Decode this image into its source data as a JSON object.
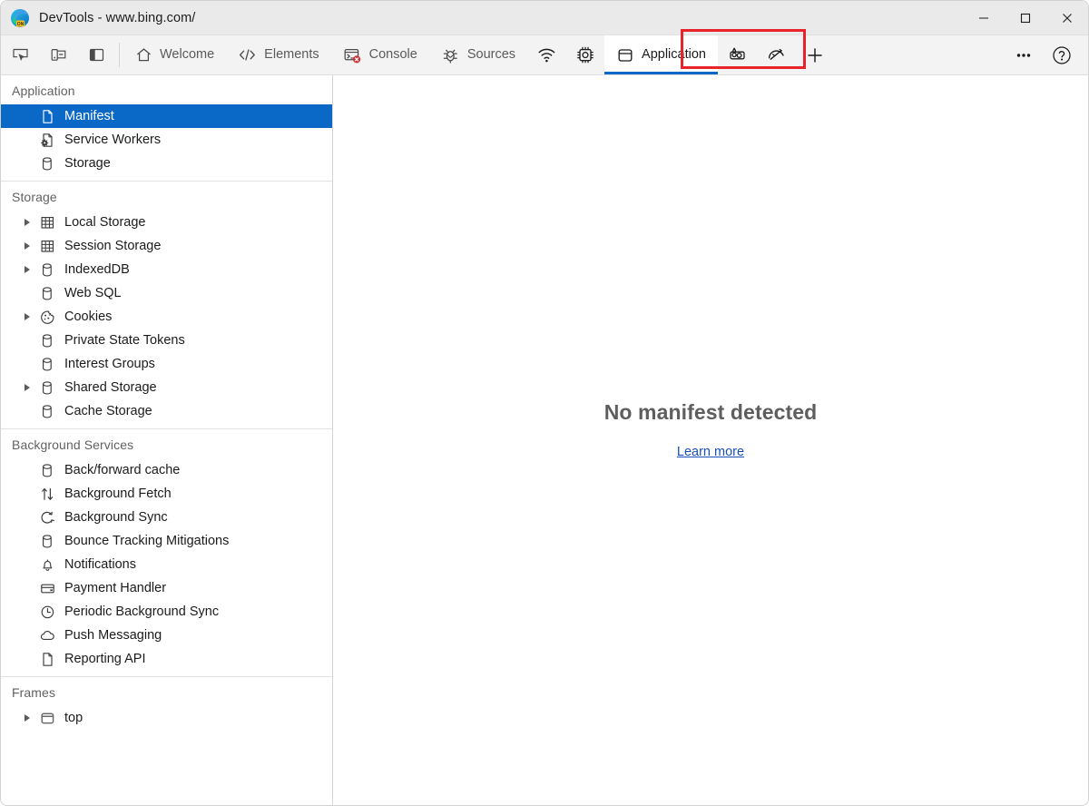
{
  "window": {
    "title": "DevTools - www.bing.com/",
    "logo_icon": "edge-devtools-logo",
    "controls": [
      {
        "name": "minimize",
        "icon": "minimize-icon"
      },
      {
        "name": "maximize",
        "icon": "maximize-icon"
      },
      {
        "name": "close",
        "icon": "close-icon"
      }
    ]
  },
  "colors": {
    "accent": "#0a68c7",
    "selection": "#0a68c7",
    "annotation": "#e8232a",
    "link": "#1a4fba",
    "error_badge": "#d13438",
    "titlebar_bg": "#eaeaea",
    "toolbar_bg": "#f3f3f3"
  },
  "toolbar": {
    "left_buttons": [
      {
        "name": "inspect-element-button",
        "icon": "inspect-cursor-icon",
        "label": "Inspect"
      },
      {
        "name": "device-emulation-button",
        "icon": "device-toggle-icon",
        "label": "Toggle device emulation"
      },
      {
        "name": "dock-side-button",
        "icon": "dock-panel-icon",
        "label": "Dock side"
      }
    ],
    "tabs": [
      {
        "name": "tab-welcome",
        "label": "Welcome",
        "icon": "home-icon",
        "active": false
      },
      {
        "name": "tab-elements",
        "label": "Elements",
        "icon": "code-brackets-icon",
        "active": false
      },
      {
        "name": "tab-console",
        "label": "Console",
        "icon": "console-icon",
        "active": false,
        "badge": "error"
      },
      {
        "name": "tab-sources",
        "label": "Sources",
        "icon": "bug-icon",
        "active": false
      },
      {
        "name": "tab-network",
        "label": "",
        "icon": "wifi-icon",
        "active": false
      },
      {
        "name": "tab-performance",
        "label": "",
        "icon": "cpu-chip-icon",
        "active": false
      },
      {
        "name": "tab-application",
        "label": "Application",
        "icon": "storage-box-icon",
        "active": true
      },
      {
        "name": "tab-memory",
        "label": "",
        "icon": "memory-heap-icon",
        "active": false
      },
      {
        "name": "tab-performance-insights",
        "label": "",
        "icon": "gauge-icon",
        "active": false
      },
      {
        "name": "tab-add-panel",
        "label": "",
        "icon": "plus-icon",
        "active": false
      }
    ],
    "right_buttons": [
      {
        "name": "more-tools-button",
        "icon": "ellipsis-icon",
        "label": "Customize and control DevTools"
      },
      {
        "name": "help-button",
        "icon": "question-circle-icon",
        "label": "Help"
      }
    ]
  },
  "annotation": {
    "target": "tab-application",
    "shape": "rectangle",
    "color": "#e8232a"
  },
  "sidebar": {
    "sections": [
      {
        "name": "application",
        "header": "Application",
        "items": [
          {
            "name": "sidebar-item-manifest",
            "label": "Manifest",
            "icon": "document-icon",
            "expandable": false,
            "selected": true
          },
          {
            "name": "sidebar-item-service-workers",
            "label": "Service Workers",
            "icon": "service-worker-icon",
            "expandable": false,
            "selected": false
          },
          {
            "name": "sidebar-item-storage",
            "label": "Storage",
            "icon": "database-icon",
            "expandable": false,
            "selected": false
          }
        ]
      },
      {
        "name": "storage",
        "header": "Storage",
        "items": [
          {
            "name": "sidebar-item-local-storage",
            "label": "Local Storage",
            "icon": "table-grid-icon",
            "expandable": true,
            "selected": false
          },
          {
            "name": "sidebar-item-session-storage",
            "label": "Session Storage",
            "icon": "table-grid-icon",
            "expandable": true,
            "selected": false
          },
          {
            "name": "sidebar-item-indexeddb",
            "label": "IndexedDB",
            "icon": "database-icon",
            "expandable": true,
            "selected": false
          },
          {
            "name": "sidebar-item-web-sql",
            "label": "Web SQL",
            "icon": "database-icon",
            "expandable": false,
            "selected": false
          },
          {
            "name": "sidebar-item-cookies",
            "label": "Cookies",
            "icon": "cookie-icon",
            "expandable": true,
            "selected": false
          },
          {
            "name": "sidebar-item-private-state-tokens",
            "label": "Private State Tokens",
            "icon": "database-icon",
            "expandable": false,
            "selected": false
          },
          {
            "name": "sidebar-item-interest-groups",
            "label": "Interest Groups",
            "icon": "database-icon",
            "expandable": false,
            "selected": false
          },
          {
            "name": "sidebar-item-shared-storage",
            "label": "Shared Storage",
            "icon": "database-icon",
            "expandable": true,
            "selected": false
          },
          {
            "name": "sidebar-item-cache-storage",
            "label": "Cache Storage",
            "icon": "database-icon",
            "expandable": false,
            "selected": false
          }
        ]
      },
      {
        "name": "background-services",
        "header": "Background Services",
        "items": [
          {
            "name": "sidebar-item-back-forward-cache",
            "label": "Back/forward cache",
            "icon": "database-icon",
            "expandable": false,
            "selected": false
          },
          {
            "name": "sidebar-item-background-fetch",
            "label": "Background Fetch",
            "icon": "arrows-up-down-icon",
            "expandable": false,
            "selected": false
          },
          {
            "name": "sidebar-item-background-sync",
            "label": "Background Sync",
            "icon": "sync-circle-icon",
            "expandable": false,
            "selected": false
          },
          {
            "name": "sidebar-item-bounce-tracking-mitigations",
            "label": "Bounce Tracking Mitigations",
            "icon": "database-icon",
            "expandable": false,
            "selected": false
          },
          {
            "name": "sidebar-item-notifications",
            "label": "Notifications",
            "icon": "bell-icon",
            "expandable": false,
            "selected": false
          },
          {
            "name": "sidebar-item-payment-handler",
            "label": "Payment Handler",
            "icon": "credit-card-icon",
            "expandable": false,
            "selected": false
          },
          {
            "name": "sidebar-item-periodic-background-sync",
            "label": "Periodic Background Sync",
            "icon": "clock-icon",
            "expandable": false,
            "selected": false
          },
          {
            "name": "sidebar-item-push-messaging",
            "label": "Push Messaging",
            "icon": "cloud-icon",
            "expandable": false,
            "selected": false
          },
          {
            "name": "sidebar-item-reporting-api",
            "label": "Reporting API",
            "icon": "document-icon",
            "expandable": false,
            "selected": false
          }
        ]
      },
      {
        "name": "frames",
        "header": "Frames",
        "items": [
          {
            "name": "sidebar-item-top-frame",
            "label": "top",
            "icon": "frame-window-icon",
            "expandable": true,
            "selected": false
          }
        ]
      }
    ]
  },
  "main": {
    "empty_state": {
      "title": "No manifest detected",
      "link_label": "Learn more"
    }
  }
}
